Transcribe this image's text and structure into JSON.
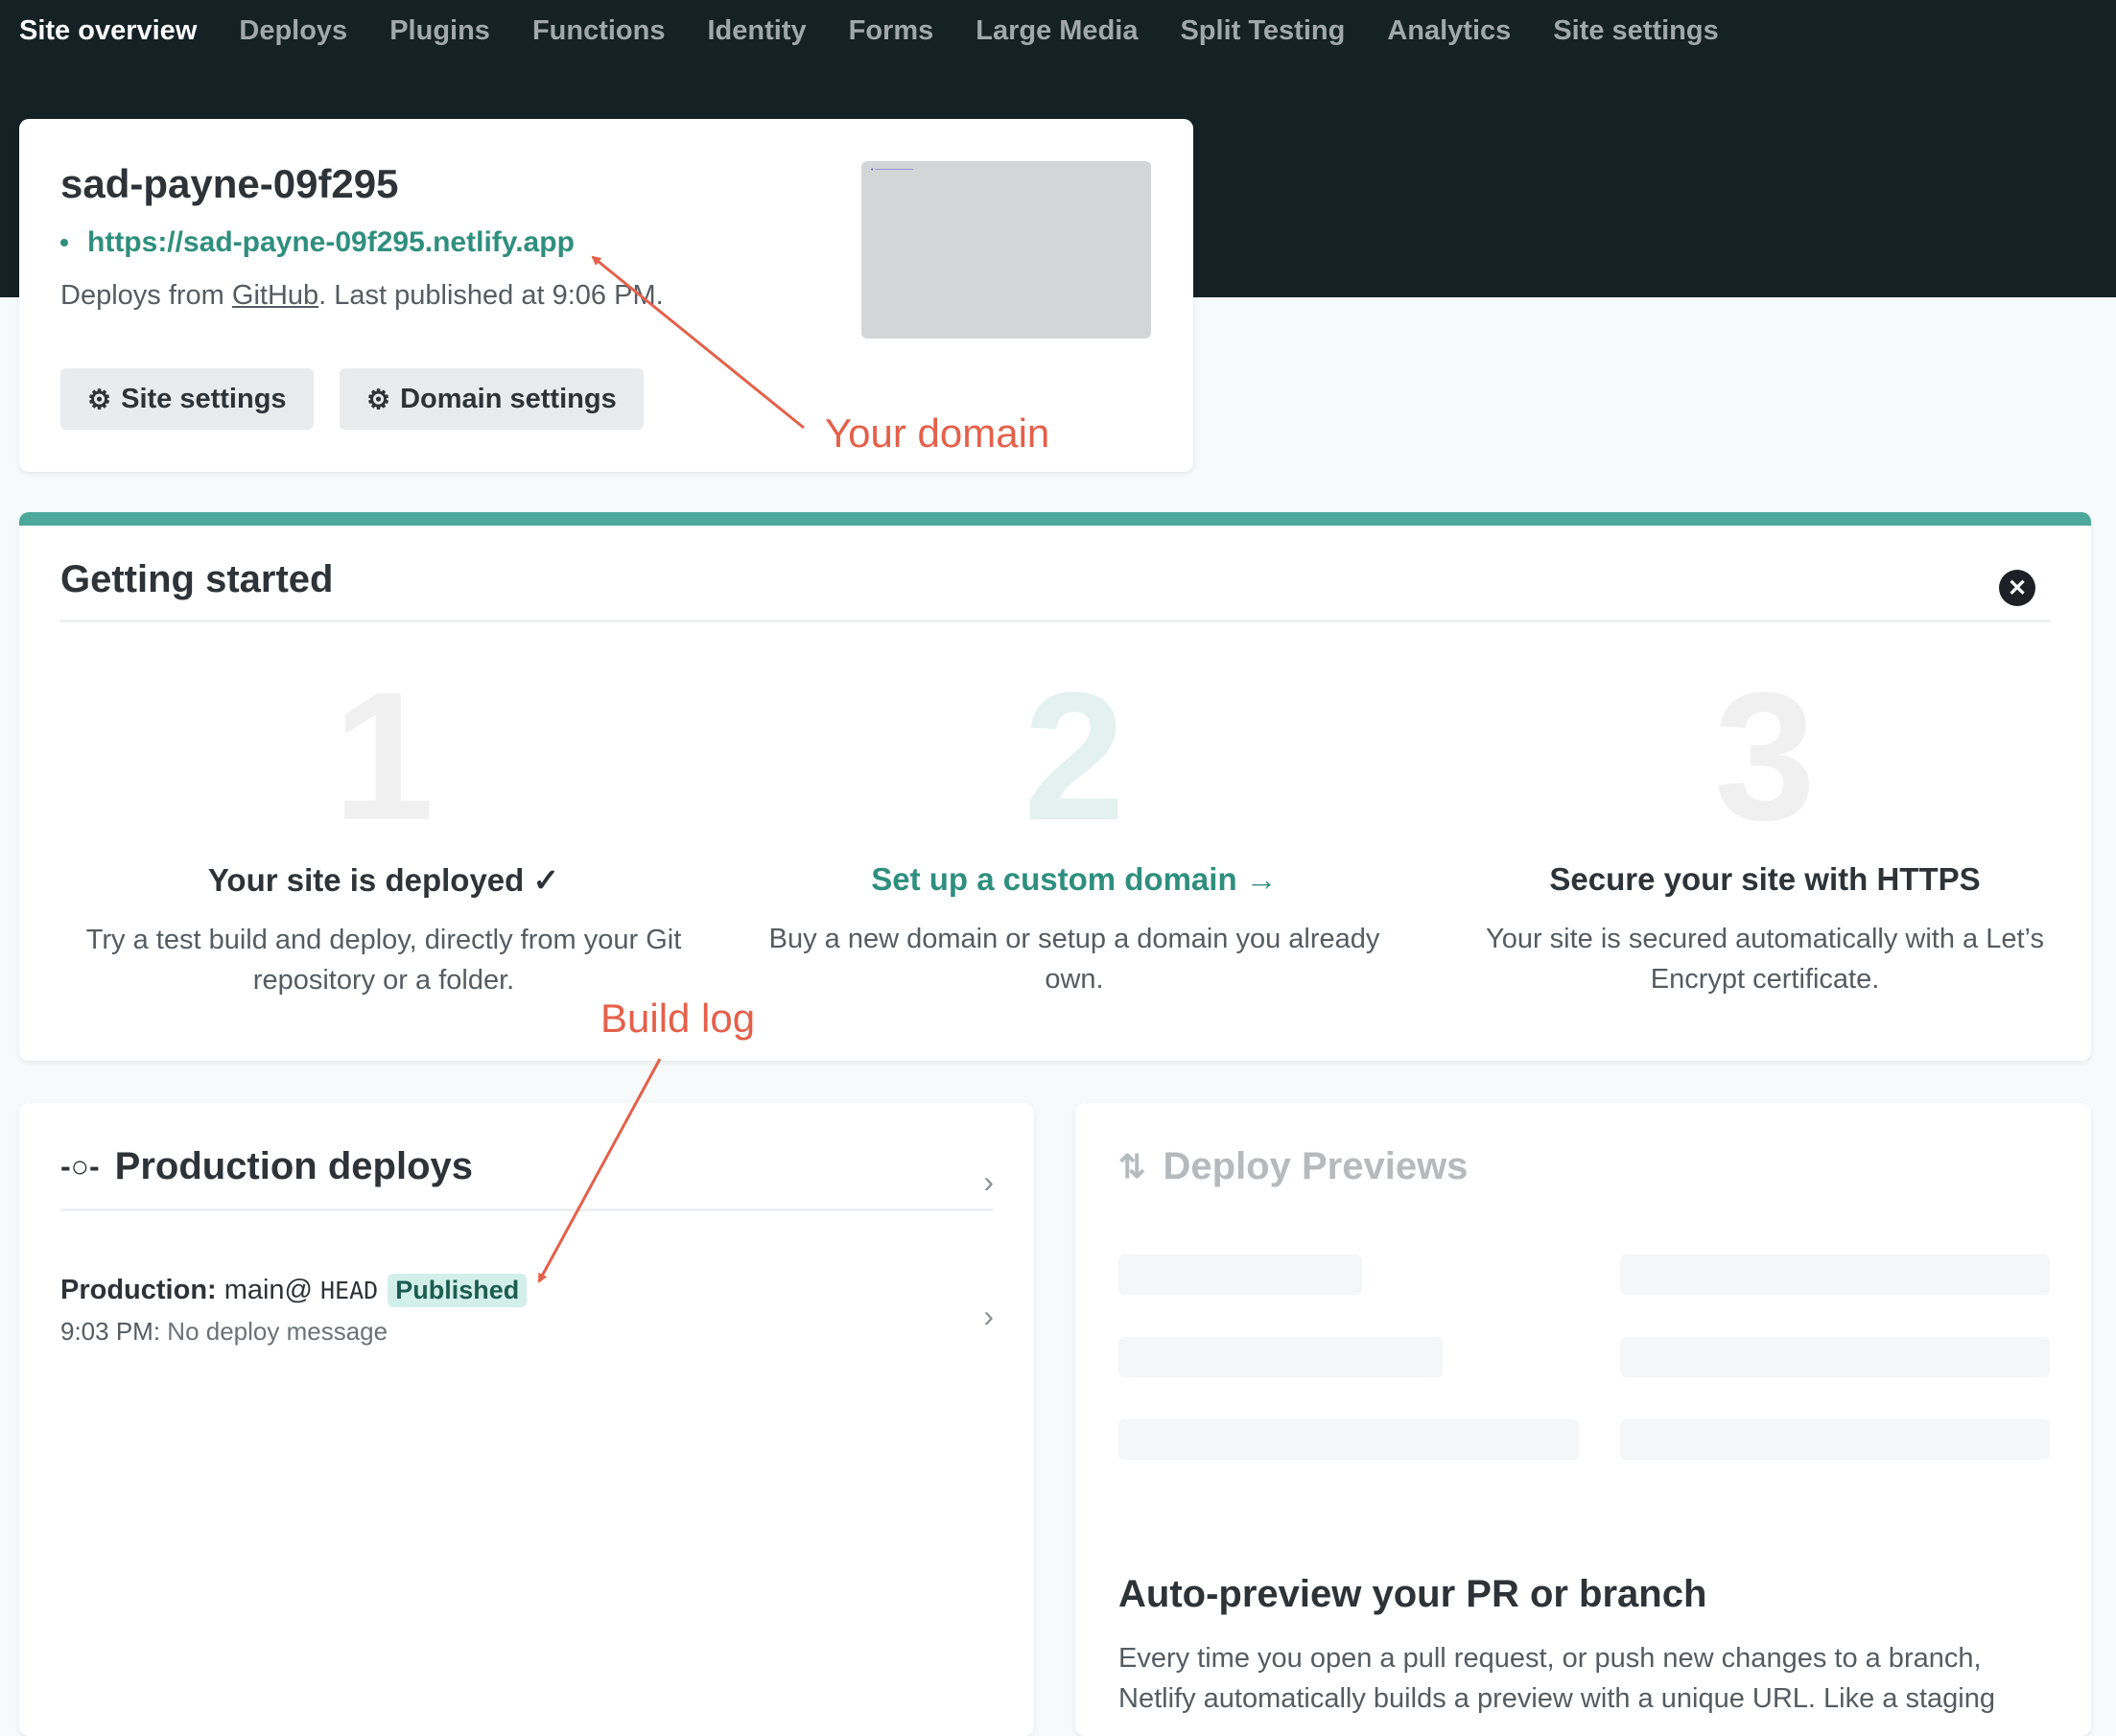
{
  "nav": {
    "items": [
      {
        "label": "Site overview",
        "active": true
      },
      {
        "label": "Deploys"
      },
      {
        "label": "Plugins"
      },
      {
        "label": "Functions"
      },
      {
        "label": "Identity"
      },
      {
        "label": "Forms"
      },
      {
        "label": "Large Media"
      },
      {
        "label": "Split Testing"
      },
      {
        "label": "Analytics"
      },
      {
        "label": "Site settings"
      }
    ]
  },
  "site": {
    "name": "sad-payne-09f295",
    "url": "https://sad-payne-09f295.netlify.app",
    "meta_prefix": "Deploys from ",
    "meta_link": "GitHub",
    "meta_suffix": ". Last published at 9:06 PM.",
    "site_settings_label": "Site settings",
    "domain_settings_label": "Domain settings",
    "gear_icon": "gear-icon"
  },
  "getting_started": {
    "title": "Getting started",
    "close_icon": "close-icon",
    "steps": [
      {
        "number": "1",
        "title": "Your site is deployed ✓",
        "description": "Try a test build and deploy, directly from your Git repository or a folder."
      },
      {
        "number": "2",
        "title": "Set up a custom domain →",
        "description": "Buy a new domain or setup a domain you already own."
      },
      {
        "number": "3",
        "title": "Secure your site with HTTPS",
        "description": "Your site is secured automatically with a Let’s Encrypt certificate."
      }
    ]
  },
  "production_deploys": {
    "title": "Production deploys",
    "icon": "commit-icon",
    "deploy": {
      "prefix": "Production:",
      "ref": "main@",
      "ref_head": "HEAD",
      "status": "Published",
      "time": "9:03 PM:",
      "message": "No deploy message"
    }
  },
  "deploy_previews": {
    "title": "Deploy Previews",
    "icon": "pull-request-icon",
    "auto_title": "Auto-preview your PR or branch",
    "auto_desc": "Every time you open a pull request, or push new changes to a branch, Netlify automatically builds a preview with a unique URL. Like a staging"
  },
  "annotations": {
    "your_domain": "Your domain",
    "build_log": "Build log",
    "color": "#e4604a"
  },
  "colors": {
    "topbar": "#142125",
    "accent": "#4ba89a",
    "link": "#2f8f7e",
    "badge_bg": "#d2efea"
  }
}
